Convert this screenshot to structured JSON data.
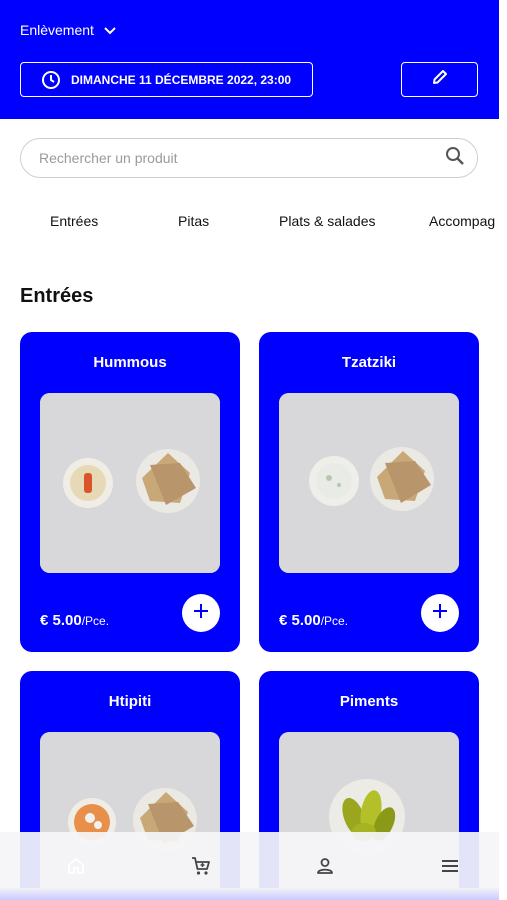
{
  "header": {
    "mode_label": "Enlèvement",
    "datetime": "DIMANCHE 11 DÉCEMBRE 2022, 23:00",
    "accent": "#0000ff"
  },
  "search": {
    "placeholder": "Rechercher un produit"
  },
  "categories": [
    {
      "label": "Entrées"
    },
    {
      "label": "Pitas"
    },
    {
      "label": "Plats & salades"
    },
    {
      "label": "Accompag"
    }
  ],
  "section": {
    "title": "Entrées"
  },
  "products": [
    {
      "name": "Hummous",
      "price": "€ 5.00",
      "unit": "/Pce."
    },
    {
      "name": "Tzatziki",
      "price": "€ 5.00",
      "unit": "/Pce."
    },
    {
      "name": "Htipiti"
    },
    {
      "name": "Piments"
    }
  ],
  "nav": [
    {
      "icon": "home-icon"
    },
    {
      "icon": "cart-icon"
    },
    {
      "icon": "user-icon"
    },
    {
      "icon": "menu-icon"
    }
  ]
}
